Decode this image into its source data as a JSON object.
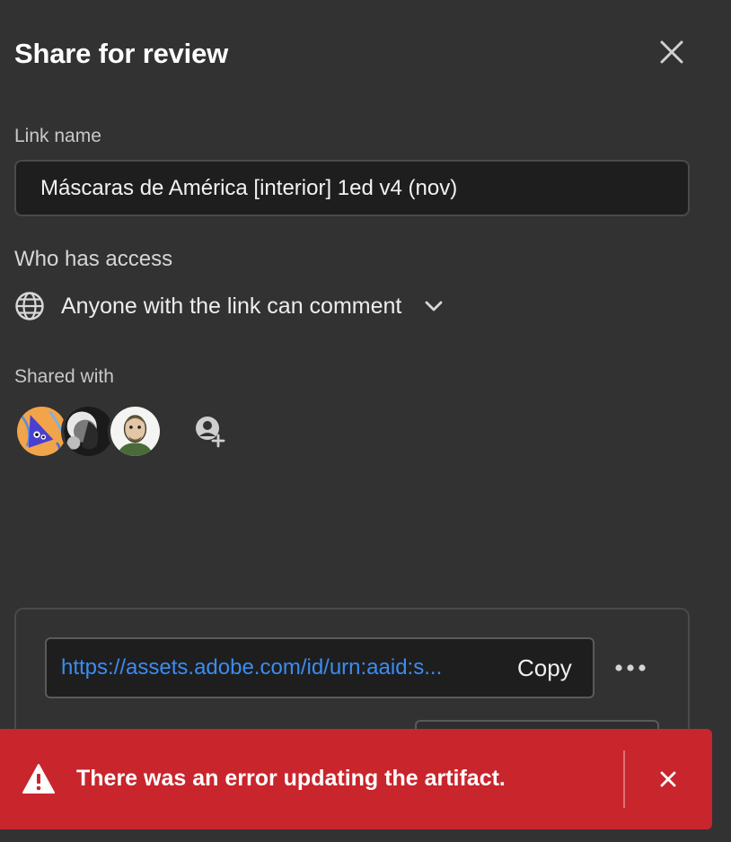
{
  "dialog": {
    "title": "Share for review",
    "close_icon": "close-icon"
  },
  "link_name": {
    "label": "Link name",
    "value": "Máscaras de América [interior] 1ed v4 (nov)"
  },
  "access": {
    "label": "Who has access",
    "icon": "globe-icon",
    "value": "Anyone with the link can comment",
    "dropdown_icon": "chevron-down-icon"
  },
  "shared_with": {
    "label": "Shared with",
    "avatars": [
      "avatar-user-1",
      "avatar-user-2",
      "avatar-user-3"
    ],
    "add_icon": "add-user-icon"
  },
  "share_link": {
    "url": "https://assets.adobe.com/id/urn:aaid:s...",
    "copy_label": "Copy",
    "more_icon": "more-options-icon"
  },
  "toast": {
    "icon": "warning-icon",
    "message": "There was an error updating the artifact.",
    "close_icon": "close-icon",
    "color": "#c9252c"
  },
  "colors": {
    "background": "#323232",
    "input_background": "#1e1e1e",
    "link": "#3b8cf0",
    "error": "#c9252c"
  }
}
